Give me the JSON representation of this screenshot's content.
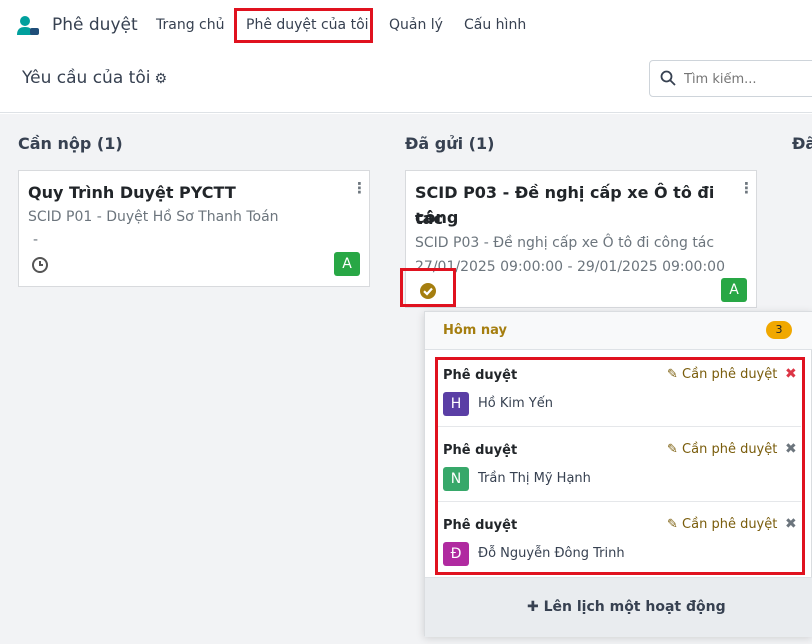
{
  "app": {
    "name": "Phê duyệt"
  },
  "nav": {
    "items": [
      {
        "label": "Trang chủ"
      },
      {
        "label": "Phê duyệt của tôi"
      },
      {
        "label": "Quản lý"
      },
      {
        "label": "Cấu hình"
      }
    ]
  },
  "control": {
    "breadcrumb": "Yêu cầu của tôi",
    "search_placeholder": "Tìm kiếm..."
  },
  "columns": [
    {
      "title": "Cần nộp (1)"
    },
    {
      "title": "Đã gửi (1)"
    },
    {
      "title": "Đã"
    }
  ],
  "cards": [
    {
      "title": "Quy Trình Duyệt PYCTT",
      "subtitle": "SCID P01 - Duyệt Hồ Sơ Thanh Toán",
      "extra": "-",
      "avatar": "A",
      "avatar_color": "#28a745",
      "status_icon": "clock-icon"
    },
    {
      "title_line1": "SCID P03 - Đề nghị cấp xe Ô tô đi công",
      "title_line2": "tác",
      "subtitle": "SCID P03 - Đề nghị cấp xe Ô tô đi công tác",
      "dates": "27/01/2025 09:00:00 - 29/01/2025 09:00:00",
      "avatar": "A",
      "avatar_color": "#28a745",
      "status_icon": "check-circle-icon"
    }
  ],
  "popover": {
    "header": "Hôm nay",
    "count": "3",
    "activities": [
      {
        "type": "Phê duyệt",
        "action": "Cần phê duyệt",
        "user": "Hồ Kim Yến",
        "initial": "H",
        "avatar_color": "#5a3ea5",
        "close_color": "#dc3545"
      },
      {
        "type": "Phê duyệt",
        "action": "Cần phê duyệt",
        "user": "Trần Thị Mỹ Hạnh",
        "initial": "N",
        "avatar_color": "#37a86a",
        "close_color": "#6c757d"
      },
      {
        "type": "Phê duyệt",
        "action": "Cần phê duyệt",
        "user": "Đỗ Nguyễn Đông Trinh",
        "initial": "Đ",
        "avatar_color": "#b02aa0",
        "close_color": "#6c757d"
      }
    ],
    "footer": "Lên lịch một hoạt động"
  },
  "colors": {
    "brand": "#00a09d",
    "highlight": "#e0121f",
    "activity_accent": "#a57e0f"
  }
}
